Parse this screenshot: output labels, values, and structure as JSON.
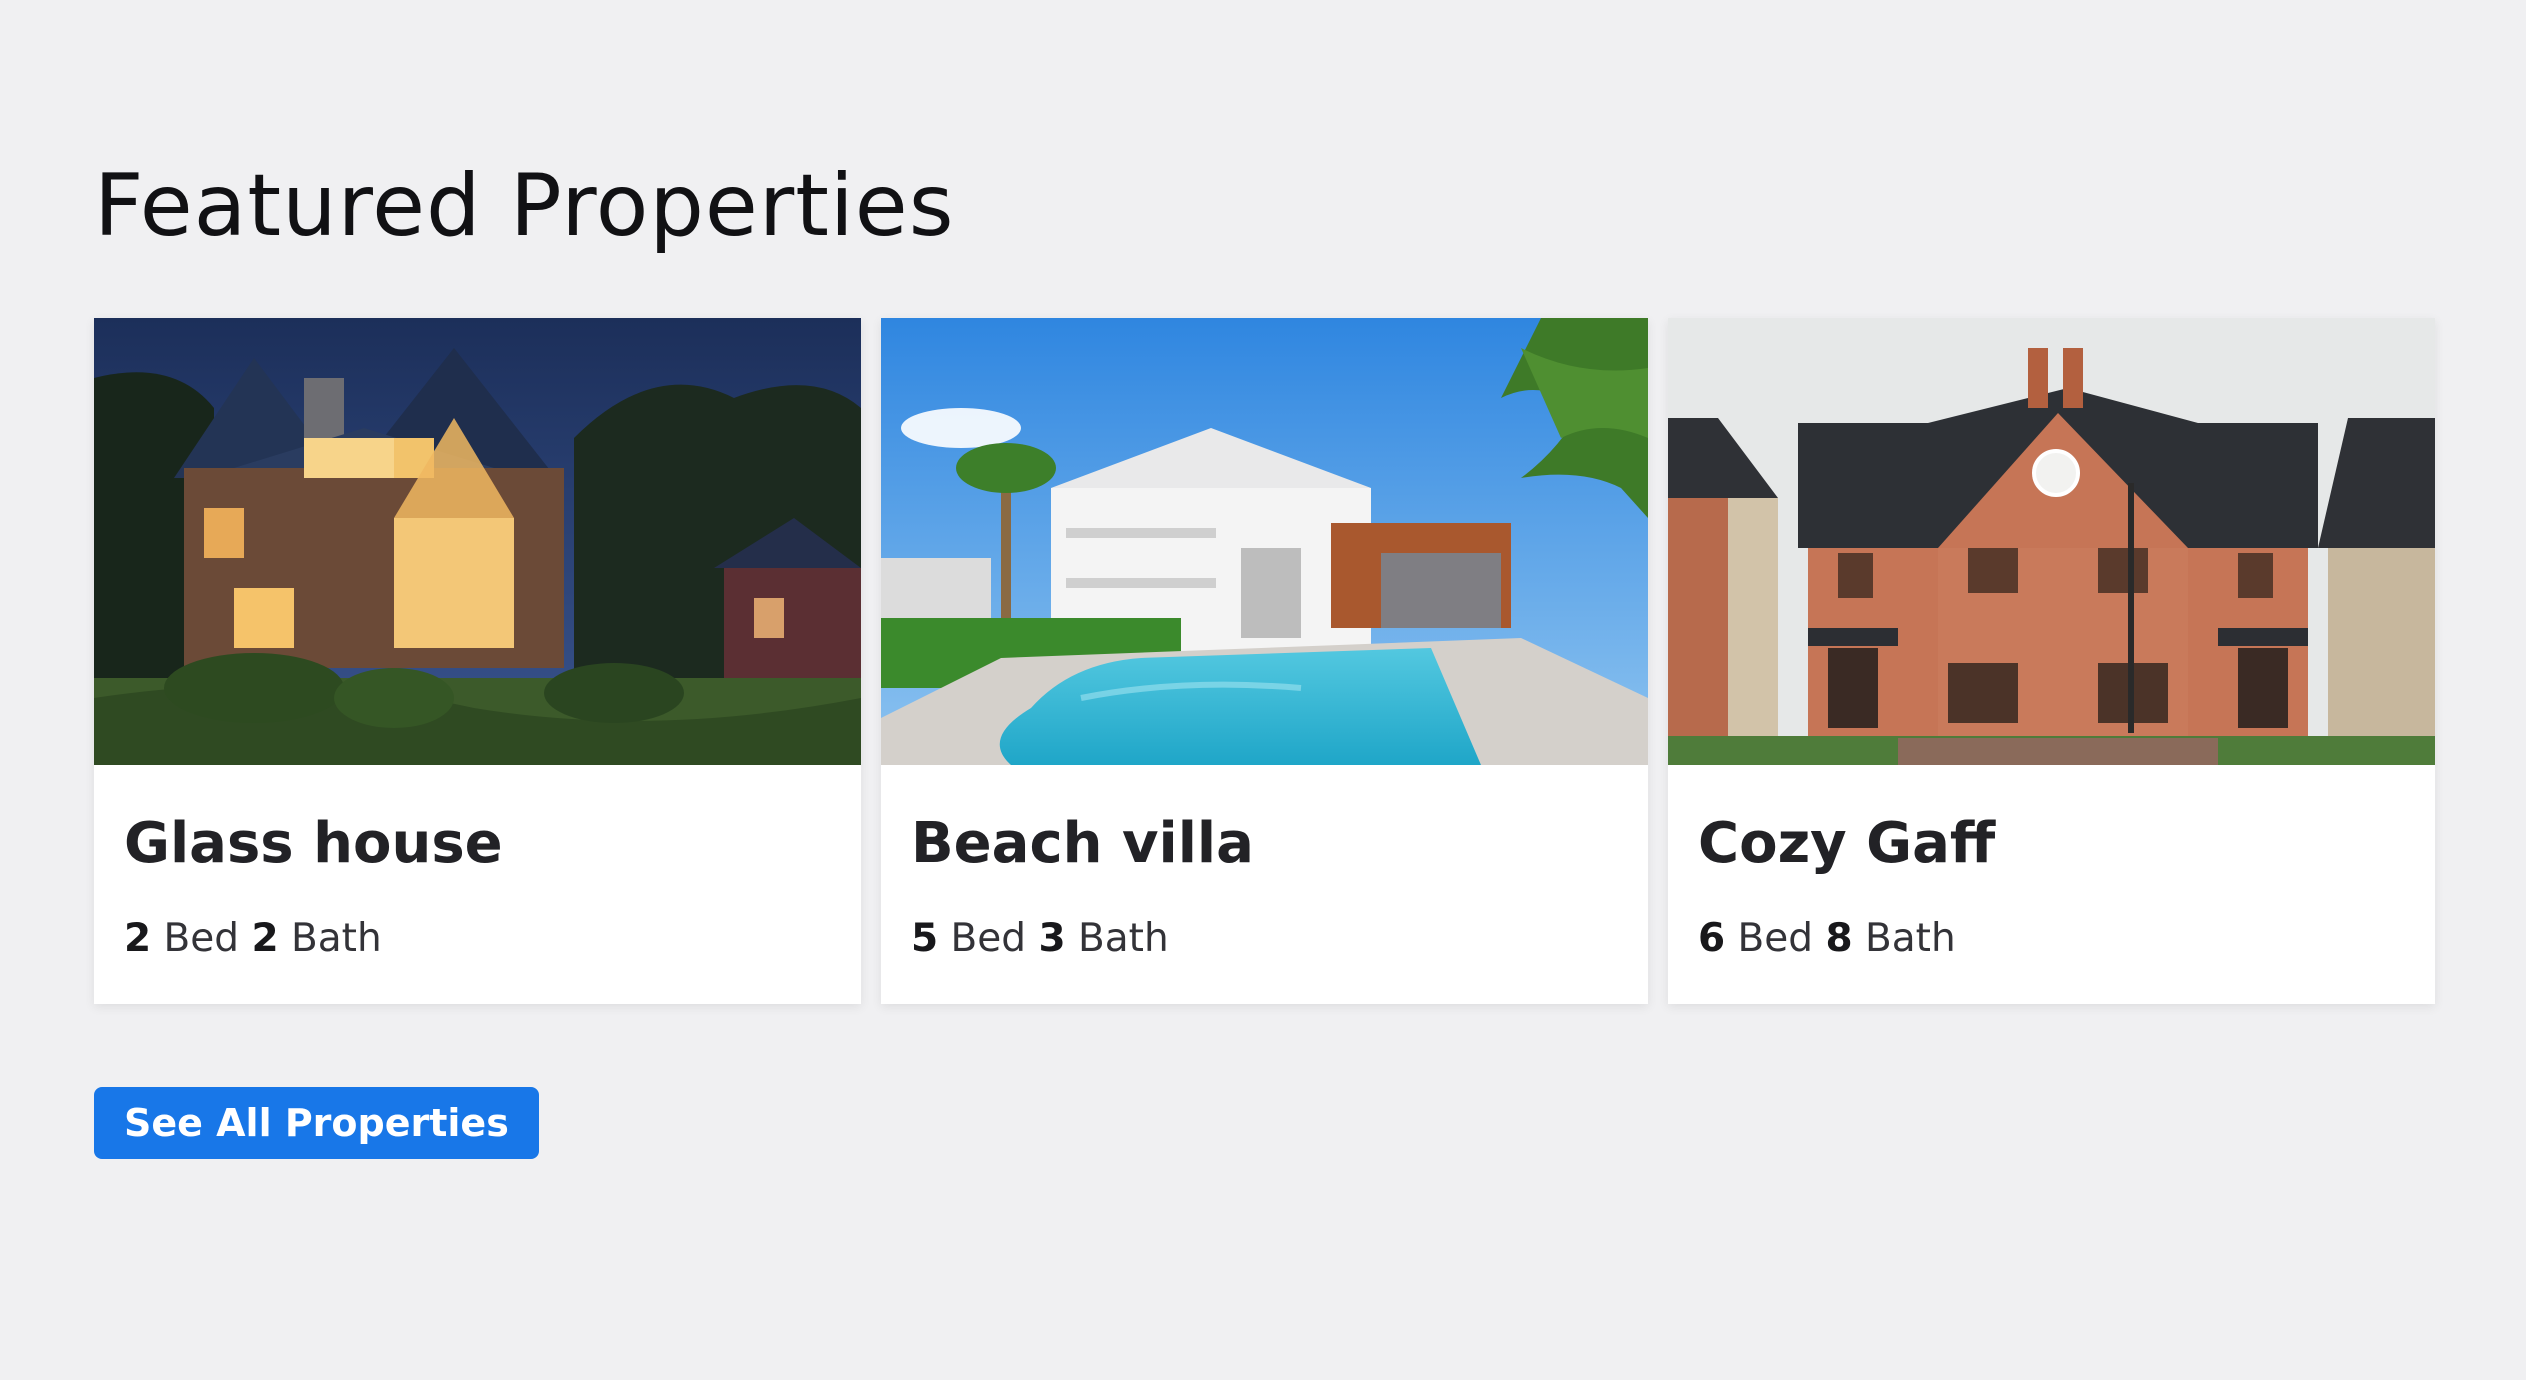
{
  "section": {
    "title": "Featured Properties"
  },
  "properties": [
    {
      "name": "Glass house",
      "beds": "2",
      "bed_label": "Bed",
      "baths": "2",
      "bath_label": "Bath",
      "image_icon": "house-at-night-photo"
    },
    {
      "name": "Beach villa",
      "beds": "5",
      "bed_label": "Bed",
      "baths": "3",
      "bath_label": "Bath",
      "image_icon": "villa-with-pool-photo"
    },
    {
      "name": "Cozy Gaff",
      "beds": "6",
      "bed_label": "Bed",
      "baths": "8",
      "bath_label": "Bath",
      "image_icon": "brick-house-photo"
    }
  ],
  "actions": {
    "see_all_label": "See All Properties"
  },
  "colors": {
    "background": "#f0f0f2",
    "accent": "#1877e8",
    "card": "#ffffff"
  }
}
